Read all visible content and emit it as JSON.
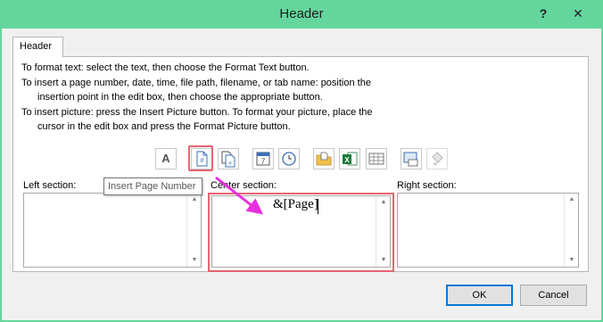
{
  "window": {
    "title": "Header",
    "help_label": "?",
    "close_label": "✕"
  },
  "tab": {
    "label": "Header"
  },
  "instructions": [
    "To format text:  select the text, then choose the Format Text button.",
    "To insert a page number, date, time, file path, filename, or tab name:  position the",
    "insertion point in the edit box, then choose the appropriate button.",
    "To insert picture: press the Insert Picture button.  To format your picture, place the",
    "cursor in the edit box and press the Format Picture button."
  ],
  "toolbar": {
    "format_text_label": "A",
    "buttons": [
      "format-text",
      "insert-page-number",
      "insert-number-of-pages",
      "insert-date",
      "insert-time",
      "insert-file-path",
      "insert-file-name",
      "insert-sheet-name",
      "insert-picture",
      "format-picture"
    ],
    "highlight_color": "#e8646e"
  },
  "tooltip": {
    "text": "Insert Page Number"
  },
  "sections": {
    "left": {
      "label": "Left section:",
      "value": ""
    },
    "center": {
      "label": "Center section:",
      "value": "&[Page]"
    },
    "right": {
      "label": "Right section:",
      "value": ""
    }
  },
  "buttons": {
    "ok": "OK",
    "cancel": "Cancel"
  },
  "colors": {
    "titlebar": "#64d69d",
    "arrow": "#e830e0",
    "highlight": "#e8646e"
  }
}
